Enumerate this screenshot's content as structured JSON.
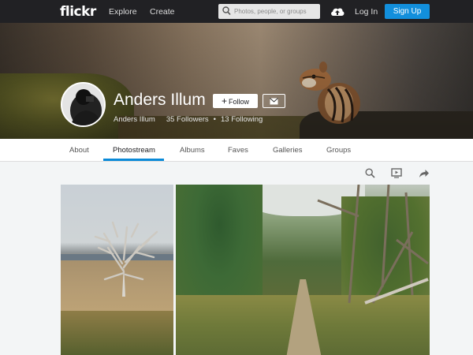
{
  "nav": {
    "logo": "flickr",
    "explore": "Explore",
    "create": "Create",
    "search_placeholder": "Photos, people, or groups",
    "login": "Log In",
    "signup": "Sign Up"
  },
  "profile": {
    "name": "Anders Illum",
    "username": "Anders Illum",
    "followers": "35 Followers",
    "following": "13 Following",
    "follow_label": "Follow"
  },
  "tabs": [
    {
      "label": "About"
    },
    {
      "label": "Photostream",
      "active": true
    },
    {
      "label": "Albums"
    },
    {
      "label": "Faves"
    },
    {
      "label": "Galleries"
    },
    {
      "label": "Groups"
    }
  ],
  "tools": [
    "search-icon",
    "slideshow-icon",
    "share-icon"
  ],
  "colors": {
    "nav_bg": "#212124",
    "signup_bg": "#128fdc",
    "tab_underline": "#0a8ad8"
  }
}
